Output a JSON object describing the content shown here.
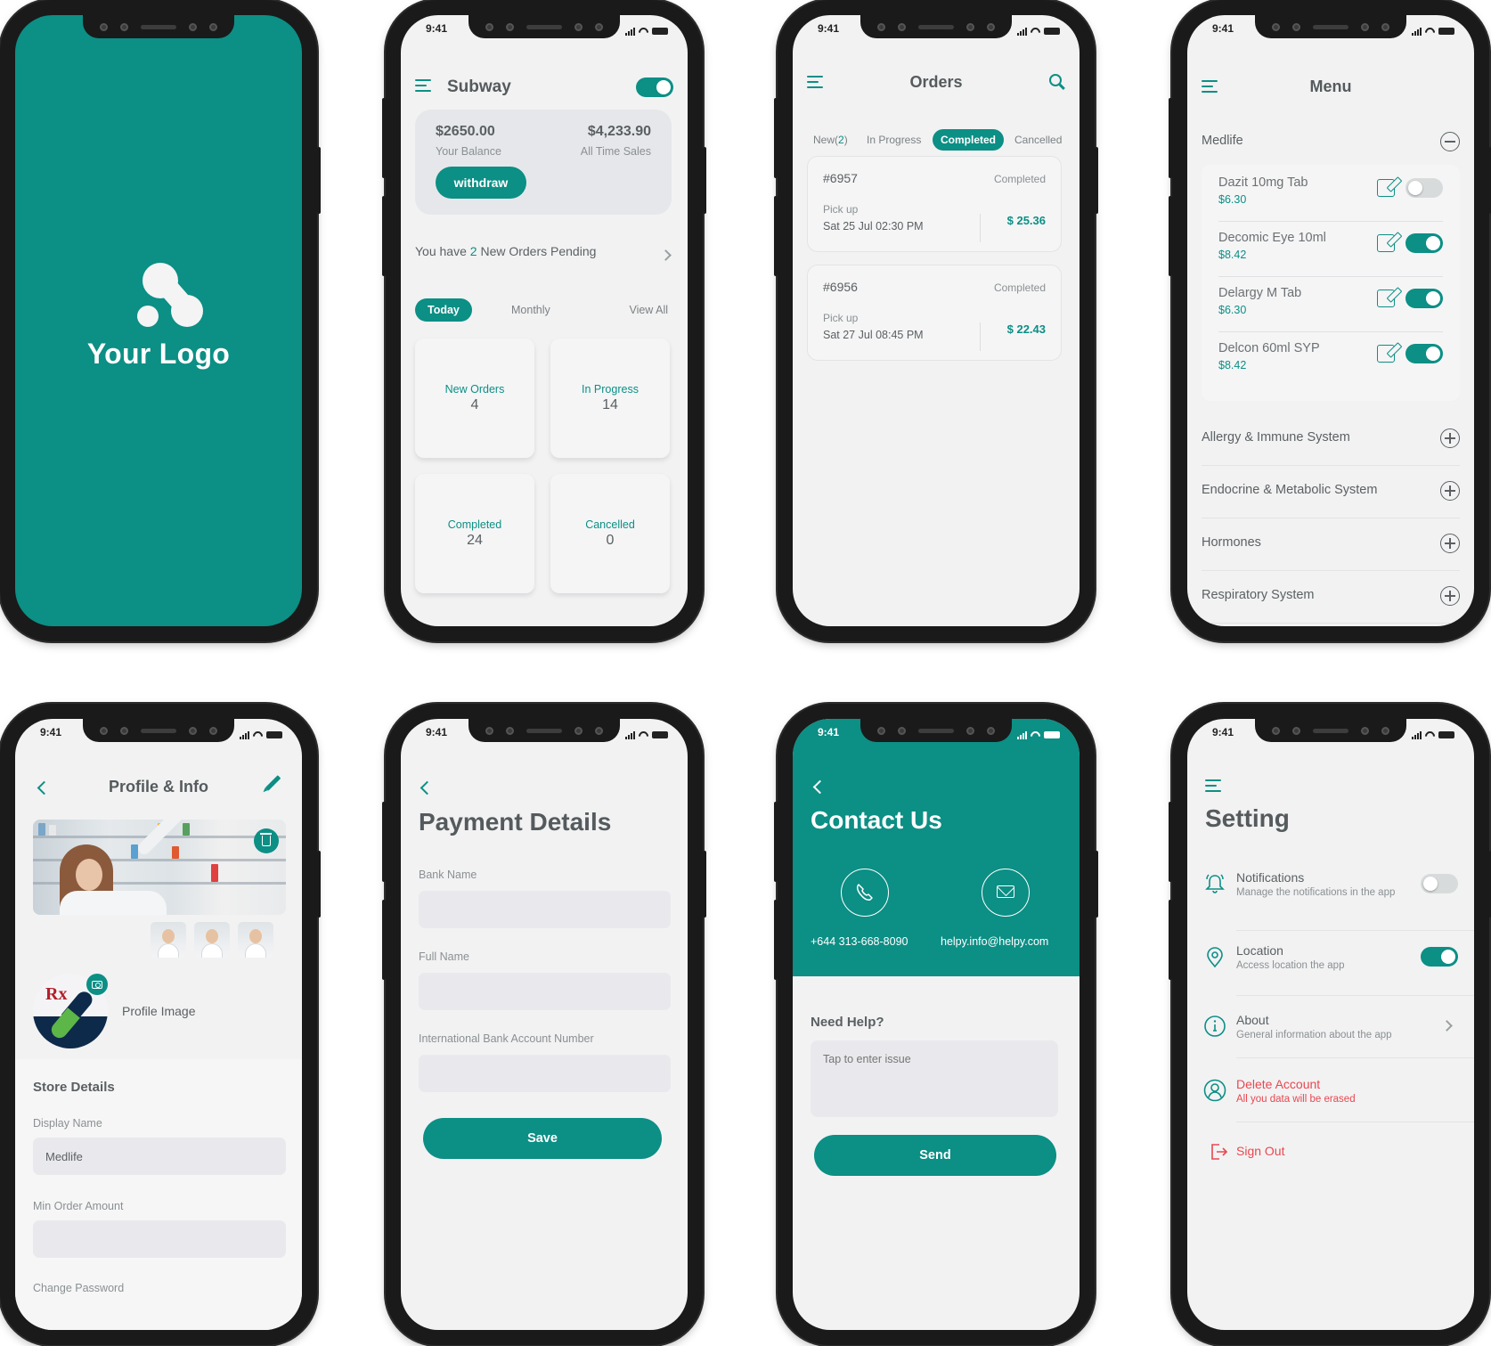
{
  "status_bar": {
    "time": "9:41"
  },
  "colors": {
    "accent": "#0c8f85",
    "danger": "#e9474f",
    "text": "#5b6163",
    "muted": "#8a9092"
  },
  "splash": {
    "logo_text": "Your Logo"
  },
  "dashboard": {
    "title": "Subway",
    "online_toggle": true,
    "balance": {
      "amount": "$2650.00",
      "label": "Your Balance"
    },
    "sales": {
      "amount": "$4,233.90",
      "label": "All Time Sales"
    },
    "withdraw_label": "withdraw",
    "pending": {
      "prefix": "You have ",
      "count": "2",
      "suffix": " New Orders Pending"
    },
    "tabs": [
      {
        "label": "Today",
        "active": true
      },
      {
        "label": "Monthly",
        "active": false
      },
      {
        "label": "View All",
        "active": false
      }
    ],
    "stats": [
      {
        "label": "New Orders",
        "value": "4"
      },
      {
        "label": "In Progress",
        "value": "14"
      },
      {
        "label": "Completed",
        "value": "24"
      },
      {
        "label": "Cancelled",
        "value": "0"
      }
    ]
  },
  "orders": {
    "title": "Orders",
    "tabs": [
      {
        "label": "New(",
        "count": "2",
        "suffix": ")",
        "active": false
      },
      {
        "label": "In Progress",
        "active": false
      },
      {
        "label": "Completed",
        "active": true
      },
      {
        "label": "Cancelled",
        "active": false
      }
    ],
    "items": [
      {
        "id": "#6957",
        "status": "Completed",
        "pickup_label": "Pick up",
        "datetime": "Sat 25 Jul 02:30 PM",
        "price": "$ 25.36"
      },
      {
        "id": "#6956",
        "status": "Completed",
        "pickup_label": "Pick up",
        "datetime": "Sat 27 Jul 08:45 PM",
        "price": "$ 22.43"
      }
    ]
  },
  "menu": {
    "title": "Menu",
    "expanded_category": "Medlife",
    "items": [
      {
        "name": "Dazit 10mg Tab",
        "price": "$6.30",
        "enabled": false
      },
      {
        "name": "Decomic Eye 10ml",
        "price": "$8.42",
        "enabled": true
      },
      {
        "name": "Delargy M Tab",
        "price": "$6.30",
        "enabled": true
      },
      {
        "name": "Delcon 60ml SYP",
        "price": "$8.42",
        "enabled": true
      }
    ],
    "categories": [
      "Allergy & Immune System",
      "Endocrine & Metabolic System",
      "Hormones",
      "Respiratory System"
    ]
  },
  "profile": {
    "title": "Profile & Info",
    "profile_image_label": "Profile Image",
    "logo_text": "Rx",
    "store_details_heading": "Store Details",
    "display_name_label": "Display Name",
    "display_name_value": "Medlife",
    "min_order_label": "Min Order Amount",
    "min_order_value": "",
    "change_password_label": "Change Password"
  },
  "payment": {
    "title": "Payment Details",
    "bank_name_label": "Bank Name",
    "full_name_label": "Full Name",
    "iban_label": "International Bank Account Number",
    "save_label": "Save"
  },
  "contact": {
    "title": "Contact Us",
    "phone": "+644 313-668-8090",
    "email": "helpy.info@helpy.com",
    "need_help": "Need Help?",
    "issue_placeholder": "Tap to enter issue",
    "send_label": "Send"
  },
  "settings": {
    "title": "Setting",
    "rows": [
      {
        "title": "Notifications",
        "subtitle": "Manage the notifications in the app",
        "toggle": false
      },
      {
        "title": "Location",
        "subtitle": "Access location the app",
        "toggle": true
      },
      {
        "title": "About",
        "subtitle": "General information about the app"
      },
      {
        "title": "Delete Account",
        "subtitle": "All you data will be erased"
      }
    ],
    "sign_out": "Sign Out"
  }
}
